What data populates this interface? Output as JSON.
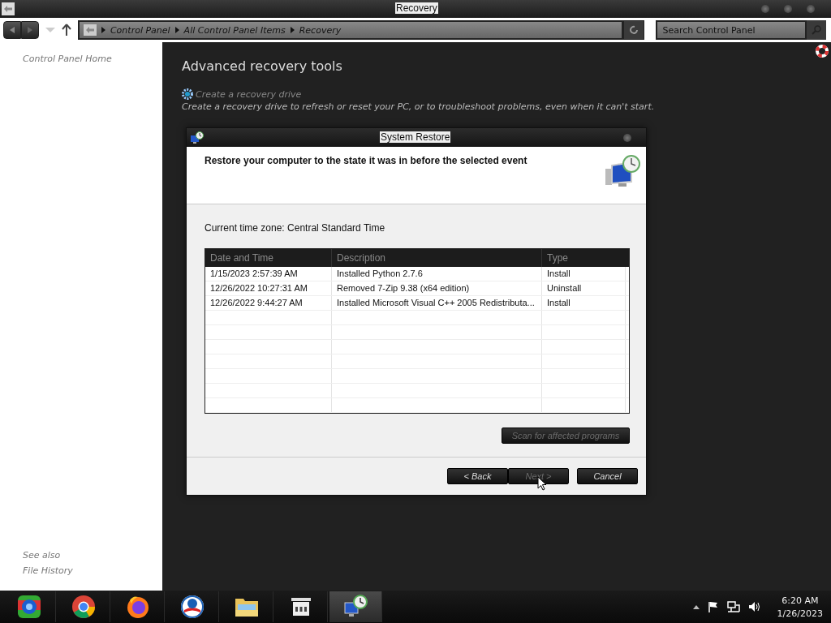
{
  "window": {
    "title": "Recovery"
  },
  "address_bar": {
    "path": [
      "Control Panel",
      "All Control Panel Items",
      "Recovery"
    ]
  },
  "search": {
    "placeholder": "Search Control Panel"
  },
  "sidebar": {
    "items": [
      "Control Panel Home"
    ],
    "see_also": {
      "heading": "See also",
      "items": [
        "File History"
      ]
    }
  },
  "main": {
    "heading": "Advanced recovery tools",
    "link": "Create a recovery drive",
    "description": "Create a recovery drive to refresh or reset your PC, or to troubleshoot problems, even when it can't start."
  },
  "dialog": {
    "title": "System Restore",
    "heading": "Restore your computer to the state it was in before the selected event",
    "time_zone": "Current time zone: Central Standard Time",
    "table": {
      "columns": [
        "Date and Time",
        "Description",
        "Type"
      ],
      "rows": [
        {
          "date": "1/15/2023 2:57:39 AM",
          "description": "Installed Python 2.7.6",
          "type": "Install"
        },
        {
          "date": "12/26/2022 10:27:31 AM",
          "description": "Removed 7-Zip 9.38 (x64 edition)",
          "type": "Uninstall"
        },
        {
          "date": "12/26/2022 9:44:27 AM",
          "description": "Installed Microsoft Visual C++ 2005 Redistributa...",
          "type": "Install"
        }
      ]
    },
    "scan_button": {
      "label": "Scan for affected programs",
      "disabled": true
    },
    "buttons": [
      {
        "label": "< Back",
        "disabled": false
      },
      {
        "label": "Next >",
        "disabled": true
      },
      {
        "label": "Cancel",
        "disabled": false
      }
    ]
  },
  "taskbar": {
    "apps": [
      {
        "kind": "ball",
        "selected": false
      },
      {
        "kind": "chrome",
        "selected": false
      },
      {
        "kind": "firefox",
        "selected": false
      },
      {
        "kind": "logo",
        "selected": false
      },
      {
        "kind": "folder",
        "selected": false
      },
      {
        "kind": "archive",
        "selected": false
      },
      {
        "kind": "restore",
        "selected": true
      }
    ],
    "clock": {
      "time": "6:20 AM",
      "date": "1/26/2023"
    }
  }
}
